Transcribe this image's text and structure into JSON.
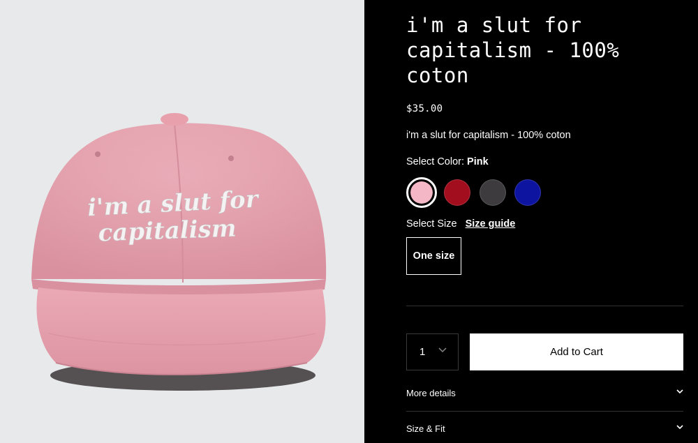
{
  "product": {
    "title": "i'm a slut for capitalism - 100% coton",
    "price": "$35.00",
    "description": "i'm a slut for capitalism - 100% coton",
    "image": {
      "embroidery_line1": "i'm a slut for",
      "embroidery_line2": "capitalism",
      "colors": {
        "background": "#e8e9eb",
        "cap": "#e8a4b0",
        "embroidery": "#f4f2f2"
      }
    }
  },
  "color_select": {
    "label": "Select Color:",
    "selected": "Pink",
    "swatches": [
      {
        "name": "Pink",
        "color": "#f4b7c6",
        "selected": true
      },
      {
        "name": "Red",
        "color": "#a30e1e",
        "selected": false
      },
      {
        "name": "Charcoal",
        "color": "#3d3b3e",
        "selected": false
      },
      {
        "name": "Navy",
        "color": "#0d15a0",
        "selected": false
      }
    ]
  },
  "size_select": {
    "label": "Select Size",
    "guide_label": "Size guide",
    "options": [
      "One size"
    ]
  },
  "cart": {
    "quantity": "1",
    "add_label": "Add to Cart"
  },
  "accordions": [
    {
      "label": "More details"
    },
    {
      "label": "Size & Fit"
    }
  ]
}
